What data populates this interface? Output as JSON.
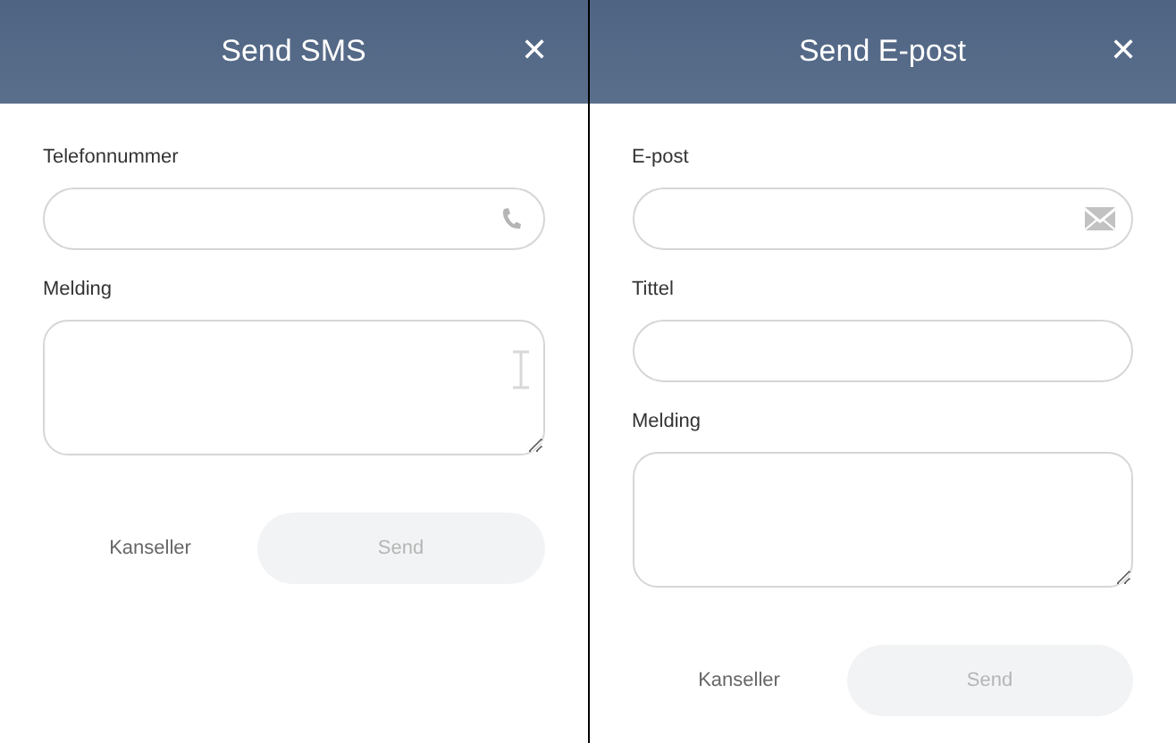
{
  "dialogs": [
    {
      "title": "Send SMS",
      "close": "✕",
      "fields": [
        {
          "kind": "tel",
          "label": "Telefonnummer"
        },
        {
          "kind": "message",
          "label": "Melding",
          "hovered": true
        }
      ],
      "cancel": "Kanseller",
      "send": {
        "label": "Send",
        "disabled": true
      }
    },
    {
      "title": "Send E-post",
      "close": "✕",
      "fields": [
        {
          "kind": "email",
          "label": "E-post"
        },
        {
          "kind": "text",
          "label": "Tittel"
        },
        {
          "kind": "message",
          "label": "Melding",
          "hovered": false
        }
      ],
      "cancel": "Kanseller",
      "send": {
        "label": "Send",
        "disabled": true
      }
    }
  ]
}
